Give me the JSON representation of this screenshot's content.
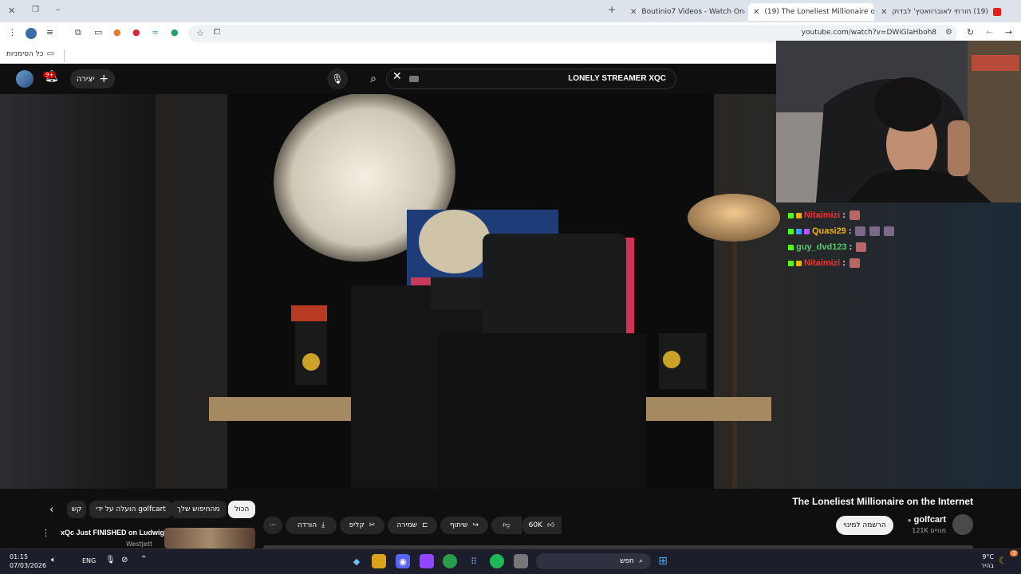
{
  "browser": {
    "tabs": [
      {
        "title": "(19) חורתי לאוברוואטץ' לבדוק",
        "active": false
      },
      {
        "title": "(19) The Loneliest Millionaire o",
        "active": true
      },
      {
        "title": "Boutinio7 Videos - Watch On-D",
        "active": false
      }
    ],
    "url": "youtube.com/watch?v=DWiGlaHboh8",
    "bookmarks_label": "כל הסימניות"
  },
  "youtube": {
    "search_query": "LONELY STREAMER XQC",
    "create_label": "יצירה",
    "notification_count": "9+",
    "video_title": "The Loneliest Millionaire on the Internet",
    "channel_name": "golfcart",
    "subscribers": "121K מנויים",
    "subscribe_label": "הרשמה למינוי",
    "actions": {
      "likes": "60K",
      "share": "שיתוף",
      "save": "שמירה",
      "clip": "קליפ",
      "download": "הורדה"
    },
    "chips": [
      "הכול",
      "מהחיפוש שלך",
      "הועלה על ידי golfcart",
      "קש"
    ],
    "recommendation": {
      "title": "xQc Just FINISHED on Ludwig",
      "channel": "WestJett"
    }
  },
  "chat": [
    {
      "user": "Nitaimizi",
      "color": "#ff2d2d"
    },
    {
      "user": "Quasi29",
      "color": "#f0b400"
    },
    {
      "user": "guy_dvd123",
      "color": "#58c86a"
    },
    {
      "user": "Nitaimizi",
      "color": "#ff2d2d"
    }
  ],
  "taskbar": {
    "time": "01:15",
    "date": "07/03/2026",
    "language": "ENG",
    "search_placeholder": "חפש",
    "temperature": "9°C",
    "weather_desc": "בהיר",
    "notification_badge": "3"
  }
}
